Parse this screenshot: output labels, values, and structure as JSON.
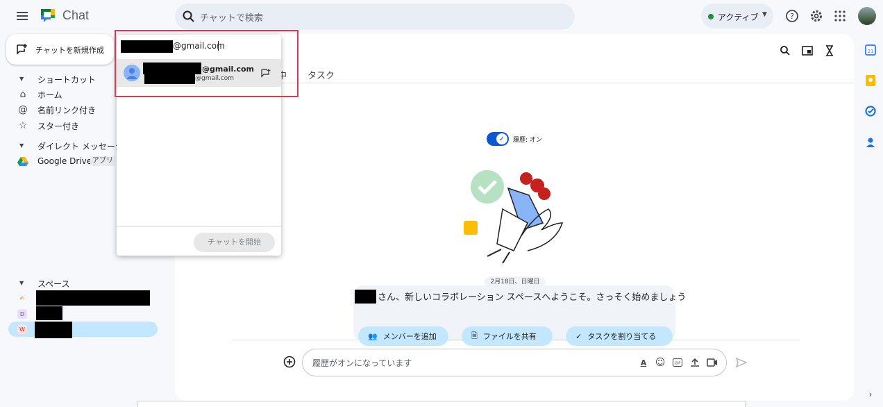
{
  "header": {
    "app_title": "Chat",
    "search_placeholder": "チャットで検索",
    "status_label": "アクティブ",
    "status_color": "#1e8e3e",
    "icons": [
      "menu-icon",
      "search-icon",
      "help-icon",
      "settings-icon",
      "apps-icon",
      "avatar"
    ]
  },
  "sidebar": {
    "new_chat_label": "チャットを新規作成",
    "shortcuts_header": "ショートカット",
    "shortcut_items": [
      {
        "label": "ホーム",
        "icon": "home-icon"
      },
      {
        "label": "名前リンク付き",
        "icon": "at-icon"
      },
      {
        "label": "スター付き",
        "icon": "star-icon"
      }
    ],
    "dm_header": "ダイレクト メッセージ",
    "dm_items": [
      {
        "label": "Google Drive",
        "badge": "アプリ",
        "icon": "google-drive-icon"
      }
    ],
    "spaces_header": "スペース",
    "space_items": [
      {
        "icon_text": "✍"
      },
      {
        "icon_text": "D"
      },
      {
        "icon_text": "W"
      }
    ]
  },
  "main": {
    "tab_partial": "中",
    "tab_tasks": "タスク",
    "history_toggle_label": "履歴: オン",
    "date_chip": "2月18日、日曜日",
    "welcome_text": "さん、新しいコラボレーション スペースへようこそ。さっそく始めましょう",
    "chips": [
      "メンバーを追加",
      "ファイルを共有",
      "タスクを割り当てる"
    ],
    "composer_placeholder": "履歴がオンになっています"
  },
  "popup": {
    "input_value": "@gmail.com",
    "suggestion_email_bold": "@gmail.com",
    "suggestion_email_sub": "@gmail.com",
    "start_button": "チャットを開始"
  },
  "colors": {
    "accent": "#0b57d0",
    "selected_space": "#c2e7ff",
    "highlight_box": "#e0384f"
  }
}
